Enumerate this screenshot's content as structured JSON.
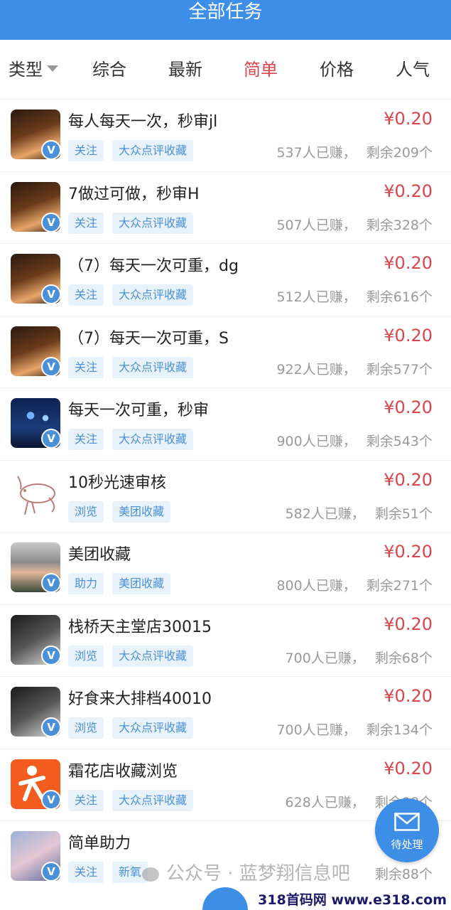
{
  "header": {
    "title": "全部任务"
  },
  "filters": [
    {
      "label": "类型",
      "caret": true,
      "active": false
    },
    {
      "label": "综合",
      "active": false
    },
    {
      "label": "最新",
      "active": false
    },
    {
      "label": "简单",
      "active": true
    },
    {
      "label": "价格",
      "active": false
    },
    {
      "label": "人气",
      "active": false
    }
  ],
  "tasks": [
    {
      "title": "每人每天一次，秒审jl",
      "price": "¥0.20",
      "tags": [
        "关注",
        "大众点评收藏"
      ],
      "earned": "537人已赚，",
      "remaining": "剩余209个",
      "thumb": "candle",
      "badge": "V"
    },
    {
      "title": "7做过可做，秒审H",
      "price": "¥0.20",
      "tags": [
        "关注",
        "大众点评收藏"
      ],
      "earned": "507人已赚，",
      "remaining": "剩余328个",
      "thumb": "candle",
      "badge": "V"
    },
    {
      "title": "（7）每天一次可重，dg",
      "price": "¥0.20",
      "tags": [
        "关注",
        "大众点评收藏"
      ],
      "earned": "512人已赚，",
      "remaining": "剩余616个",
      "thumb": "candle",
      "badge": "V"
    },
    {
      "title": "（7）每天一次可重，S",
      "price": "¥0.20",
      "tags": [
        "关注",
        "大众点评收藏"
      ],
      "earned": "922人已赚，",
      "remaining": "剩余577个",
      "thumb": "candle",
      "badge": "V"
    },
    {
      "title": "每天一次可重，秒审",
      "price": "¥0.20",
      "tags": [
        "关注",
        "大众点评收藏"
      ],
      "earned": "900人已赚，",
      "remaining": "剩余543个",
      "thumb": "fire",
      "badge": "V"
    },
    {
      "title": "10秒光速审核",
      "price": "¥0.20",
      "tags": [
        "浏览",
        "美团收藏"
      ],
      "earned": "582人已赚，",
      "remaining": "剩余51个",
      "thumb": "pig",
      "badge": ""
    },
    {
      "title": "美团收藏",
      "price": "¥0.20",
      "tags": [
        "助力",
        "美团收藏"
      ],
      "earned": "800人已赚，",
      "remaining": "剩余271个",
      "thumb": "man",
      "badge": "V"
    },
    {
      "title": "栈桥天主堂店30015",
      "price": "¥0.20",
      "tags": [
        "浏览",
        "大众点评收藏"
      ],
      "earned": "700人已赚，",
      "remaining": "剩余68个",
      "thumb": "dark",
      "badge": "V"
    },
    {
      "title": "好食来大排档40010",
      "price": "¥0.20",
      "tags": [
        "浏览",
        "大众点评收藏"
      ],
      "earned": "700人已赚，",
      "remaining": "剩余134个",
      "thumb": "dark",
      "badge": "V"
    },
    {
      "title": "霜花店收藏浏览",
      "price": "¥0.20",
      "tags": [
        "关注",
        "大众点评收藏"
      ],
      "earned": "628人已赚，",
      "remaining": "剩余98个",
      "thumb": "orange",
      "badge": "V"
    },
    {
      "title": "简单助力",
      "price": "",
      "tags": [
        "关注",
        "新氧"
      ],
      "earned": "",
      "remaining": "剩余88个",
      "thumb": "anime",
      "badge": "V"
    }
  ],
  "fab": {
    "label": "待处理",
    "icon": "mail-icon"
  },
  "watermark": {
    "text": "公众号 · 蓝梦翔信息吧",
    "site": "318首码网 www.e318.com"
  },
  "colors": {
    "brand": "#3d8ee6",
    "price": "#d9454a",
    "tag_bg": "#e8f2fb",
    "tag_text": "#4b8fd6"
  }
}
